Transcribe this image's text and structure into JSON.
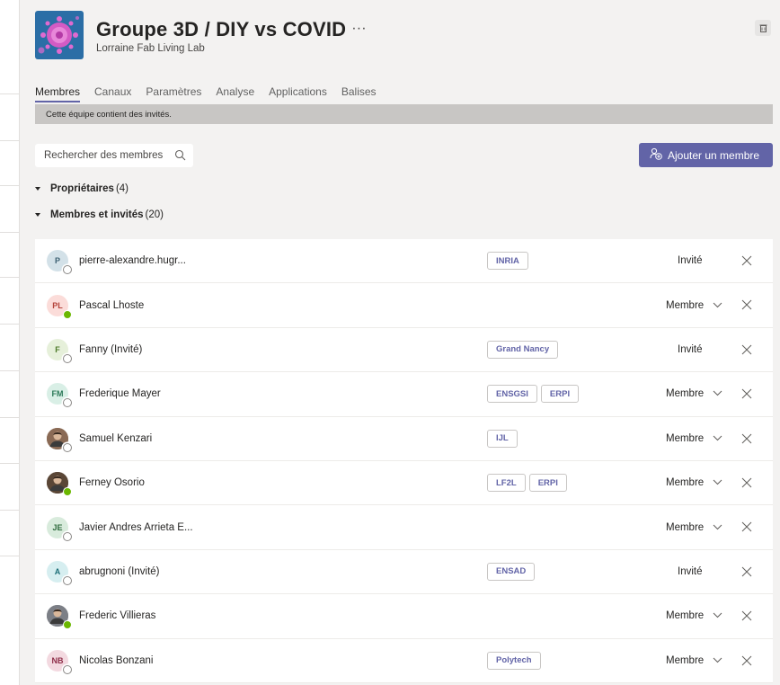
{
  "team": {
    "title": "Groupe 3D / DIY vs COVID",
    "more": "···",
    "subtitle": "Lorraine Fab Living Lab"
  },
  "tabs": [
    {
      "label": "Membres",
      "active": true
    },
    {
      "label": "Canaux",
      "active": false
    },
    {
      "label": "Paramètres",
      "active": false
    },
    {
      "label": "Analyse",
      "active": false
    },
    {
      "label": "Applications",
      "active": false
    },
    {
      "label": "Balises",
      "active": false
    }
  ],
  "banner": "Cette équipe contient des invités.",
  "search": {
    "placeholder": "Rechercher des membres"
  },
  "add_button": "Ajouter un membre",
  "sections": {
    "owners": {
      "name": "Propriétaires",
      "count": "(4)"
    },
    "members": {
      "name": "Membres et invités",
      "count": "(20)"
    }
  },
  "colors": {
    "accent": "#6264a7",
    "online": "#6bb700"
  },
  "members": [
    {
      "initials": "P",
      "name": "pierre-alexandre.hugr...",
      "tags": [
        "INRIA"
      ],
      "role": "Invité",
      "presence": "offline",
      "avatar_bg": "#d3e1e8",
      "avatar_fg": "#3d6173"
    },
    {
      "initials": "PL",
      "name": "Pascal Lhoste",
      "tags": [],
      "role": "Membre",
      "presence": "online",
      "avatar_bg": "#fbdcd9",
      "avatar_fg": "#b4433b"
    },
    {
      "initials": "F",
      "name": "Fanny (Invité)",
      "tags": [
        "Grand Nancy"
      ],
      "role": "Invité",
      "presence": "offline",
      "avatar_bg": "#e6f0da",
      "avatar_fg": "#4d7a29"
    },
    {
      "initials": "FM",
      "name": "Frederique Mayer",
      "tags": [
        "ENSGSI",
        "ERPI"
      ],
      "role": "Membre",
      "presence": "offline",
      "avatar_bg": "#d9efe6",
      "avatar_fg": "#2b7a58"
    },
    {
      "initials": "",
      "name": "Samuel Kenzari",
      "tags": [
        "IJL"
      ],
      "role": "Membre",
      "presence": "offline",
      "photo": true,
      "avatar_bg": "#8a6a55",
      "avatar_fg": "#ffffff"
    },
    {
      "initials": "",
      "name": "Ferney Osorio",
      "tags": [
        "LF2L",
        "ERPI"
      ],
      "role": "Membre",
      "presence": "online",
      "photo": true,
      "avatar_bg": "#5a4636",
      "avatar_fg": "#ffffff"
    },
    {
      "initials": "JE",
      "name": "Javier Andres Arrieta E...",
      "tags": [],
      "role": "Membre",
      "presence": "offline",
      "avatar_bg": "#d8ebdc",
      "avatar_fg": "#2e6b3d"
    },
    {
      "initials": "A",
      "name": "abrugnoni (Invité)",
      "tags": [
        "ENSAD"
      ],
      "role": "Invité",
      "presence": "offline",
      "avatar_bg": "#d6eef0",
      "avatar_fg": "#1d6f78"
    },
    {
      "initials": "",
      "name": "Frederic Villieras",
      "tags": [],
      "role": "Membre",
      "presence": "online",
      "photo": true,
      "avatar_bg": "#7c7f86",
      "avatar_fg": "#ffffff"
    },
    {
      "initials": "NB",
      "name": "Nicolas Bonzani",
      "tags": [
        "Polytech"
      ],
      "role": "Membre",
      "presence": "offline",
      "avatar_bg": "#f3d9e0",
      "avatar_fg": "#8e2d48"
    }
  ]
}
